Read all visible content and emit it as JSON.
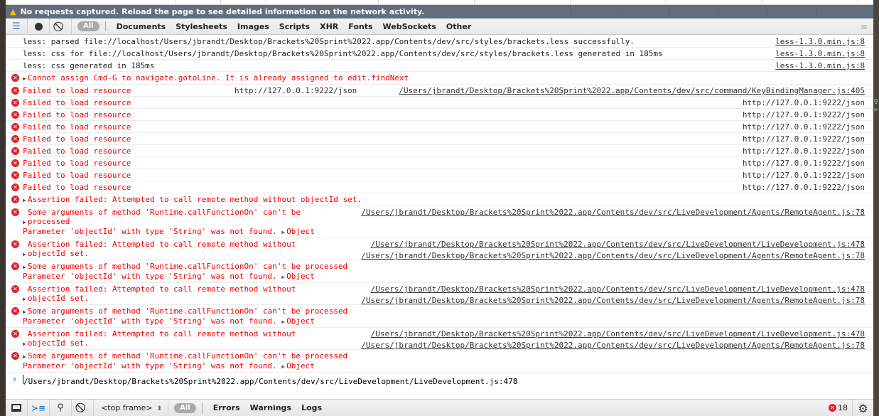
{
  "banner": {
    "icon": "warning-icon",
    "text": "No requests captured. Reload the page to see detailed information on the network activity."
  },
  "network_toolbar": {
    "filter_all": "All",
    "filters": [
      "Documents",
      "Stylesheets",
      "Images",
      "Scripts",
      "XHR",
      "Fonts",
      "WebSockets",
      "Other"
    ]
  },
  "console": {
    "rows": [
      {
        "type": "log",
        "text": "less: parsed file://localhost/Users/jbrandt/Desktop/Brackets%20Sprint%2022.app/Contents/dev/src/styles/brackets.less successfully.",
        "source": "less-1.3.0.min.js:8"
      },
      {
        "type": "log",
        "text": "less: css for file://localhost/Users/jbrandt/Desktop/Brackets%20Sprint%2022.app/Contents/dev/src/styles/brackets.less generated in 185ms",
        "source": "less-1.3.0.min.js:8"
      },
      {
        "type": "log",
        "text": "less: css generated in 185ms",
        "source": "less-1.3.0.min.js:8"
      },
      {
        "type": "error",
        "text": "Cannot assign Cmd-G to navigate.gotoLine. It is already assigned to edit.findNext",
        "expandable": true
      },
      {
        "type": "error",
        "text": "Failed to load resource",
        "url": "http://127.0.0.1:9222/json",
        "source": "/Users/jbrandt/Desktop/Brackets%20Sprint%2022.app/Contents/dev/src/command/KeyBindingManager.js:405"
      },
      {
        "type": "error",
        "text": "Failed to load resource",
        "url": "http://127.0.0.1:9222/json"
      },
      {
        "type": "error",
        "text": "Failed to load resource",
        "url": "http://127.0.0.1:9222/json"
      },
      {
        "type": "error",
        "text": "Failed to load resource",
        "url": "http://127.0.0.1:9222/json"
      },
      {
        "type": "error",
        "text": "Failed to load resource",
        "url": "http://127.0.0.1:9222/json"
      },
      {
        "type": "error",
        "text": "Failed to load resource",
        "url": "http://127.0.0.1:9222/json"
      },
      {
        "type": "error",
        "text": "Failed to load resource",
        "url": "http://127.0.0.1:9222/json"
      },
      {
        "type": "error",
        "text": "Failed to load resource",
        "url": "http://127.0.0.1:9222/json"
      },
      {
        "type": "error",
        "text": "Failed to load resource",
        "url": "http://127.0.0.1:9222/json"
      },
      {
        "type": "error",
        "text": "Assertion failed: Attempted to call remote method without objectId set.",
        "expandable": true
      },
      {
        "type": "error",
        "text": "Some arguments of method 'Runtime.callFunctionOn' can't be processed",
        "line2": "Parameter 'objectId' with type 'String' was not found.",
        "object": "Object",
        "expandable": true,
        "source": "/Users/jbrandt/Desktop/Brackets%20Sprint%2022.app/Contents/dev/src/LiveDevelopment/Agents/RemoteAgent.js:78",
        "narrow": true
      },
      {
        "type": "error",
        "text": "Assertion failed: Attempted to call remote method without objectId set.",
        "expandable": true,
        "source": "/Users/jbrandt/Desktop/Brackets%20Sprint%2022.app/Contents/dev/src/LiveDevelopment/LiveDevelopment.js:478",
        "source2": "/Users/jbrandt/Desktop/Brackets%20Sprint%2022.app/Contents/dev/src/LiveDevelopment/Agents/RemoteAgent.js:78",
        "narrow": true
      },
      {
        "type": "error",
        "text": "Some arguments of method 'Runtime.callFunctionOn' can't be processed",
        "line2": "Parameter 'objectId' with type 'String' was not found.",
        "object": "Object",
        "expandable": true
      },
      {
        "type": "error",
        "text": "Assertion failed: Attempted to call remote method without objectId set.",
        "expandable": true,
        "source": "/Users/jbrandt/Desktop/Brackets%20Sprint%2022.app/Contents/dev/src/LiveDevelopment/LiveDevelopment.js:478",
        "source2": "/Users/jbrandt/Desktop/Brackets%20Sprint%2022.app/Contents/dev/src/LiveDevelopment/Agents/RemoteAgent.js:78",
        "narrow": true
      },
      {
        "type": "error",
        "text": "Some arguments of method 'Runtime.callFunctionOn' can't be processed",
        "line2": "Parameter 'objectId' with type 'String' was not found.",
        "object": "Object",
        "expandable": true
      },
      {
        "type": "error",
        "text": "Assertion failed: Attempted to call remote method without objectId set.",
        "expandable": true,
        "source": "/Users/jbrandt/Desktop/Brackets%20Sprint%2022.app/Contents/dev/src/LiveDevelopment/LiveDevelopment.js:478",
        "source2": "/Users/jbrandt/Desktop/Brackets%20Sprint%2022.app/Contents/dev/src/LiveDevelopment/Agents/RemoteAgent.js:78",
        "narrow": true
      },
      {
        "type": "error",
        "text": "Some arguments of method 'Runtime.callFunctionOn' can't be processed",
        "line2": "Parameter 'objectId' with type 'String' was not found.",
        "object": "Object",
        "expandable": true
      }
    ],
    "trailing_source": "/Users/jbrandt/Desktop/Brackets%20Sprint%2022.app/Contents/dev/src/LiveDevelopment/LiveDevelopment.js:478",
    "prompt": ">"
  },
  "bottom_toolbar": {
    "frame_select": "<top frame>",
    "filter_all": "All",
    "filters": [
      "Errors",
      "Warnings",
      "Logs"
    ],
    "error_count": "18"
  },
  "colors": {
    "banner_bg": "#646d7d",
    "error_text": "#e00000",
    "error_icon": "#d8282f",
    "prompt": "#2c7bd6"
  }
}
